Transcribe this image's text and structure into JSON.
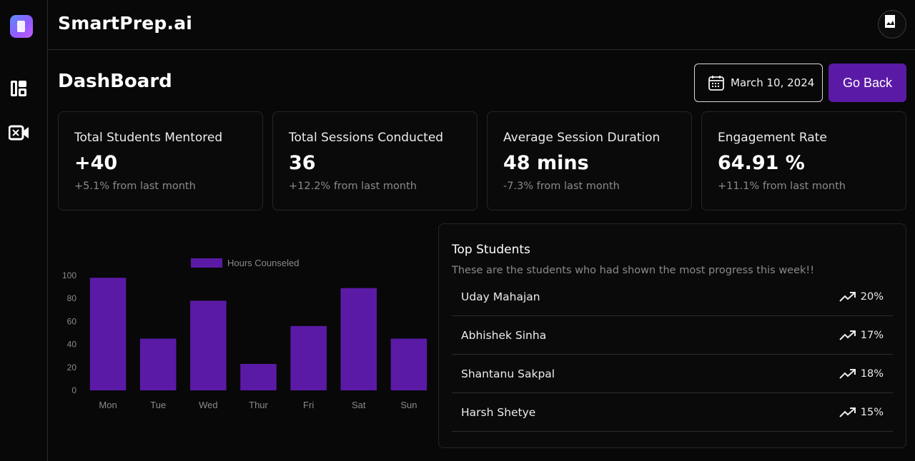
{
  "app": {
    "brand": "SmartPrep.ai"
  },
  "sidebar": {
    "items": [
      {
        "icon": "dashboard-icon"
      },
      {
        "icon": "video-camera-icon"
      }
    ]
  },
  "header": {
    "title": "DashBoard",
    "date": "March 10, 2024",
    "go_back": "Go Back"
  },
  "stats": [
    {
      "label": "Total Students Mentored",
      "value": "+40",
      "change": "+5.1% from last month"
    },
    {
      "label": "Total Sessions Conducted",
      "value": "36",
      "change": "+12.2% from last month"
    },
    {
      "label": "Average Session Duration",
      "value": "48 mins",
      "change": "-7.3% from last month"
    },
    {
      "label": "Engagement Rate",
      "value": "64.91 %",
      "change": "+11.1% from last month"
    }
  ],
  "top_students": {
    "title": "Top Students",
    "subtitle": "These are the students who had shown the most progress this week!!",
    "rows": [
      {
        "name": "Uday Mahajan",
        "pct": "20%"
      },
      {
        "name": "Abhishek Sinha",
        "pct": "17%"
      },
      {
        "name": "Shantanu Sakpal",
        "pct": "18%"
      },
      {
        "name": "Harsh Shetye",
        "pct": "15%"
      }
    ]
  },
  "colors": {
    "accent": "#5b1aa6",
    "bar": "#5b1aa6"
  },
  "chart_data": {
    "type": "bar",
    "categories": [
      "Mon",
      "Tue",
      "Wed",
      "Thur",
      "Fri",
      "Sat",
      "Sun"
    ],
    "series": [
      {
        "name": "Hours Counseled",
        "values": [
          98,
          45,
          78,
          23,
          56,
          89,
          45
        ]
      }
    ],
    "ylim": [
      0,
      100
    ],
    "yticks": [
      "0",
      "20",
      "40",
      "60",
      "80",
      "100"
    ],
    "legend": "top-center",
    "grid": false
  }
}
